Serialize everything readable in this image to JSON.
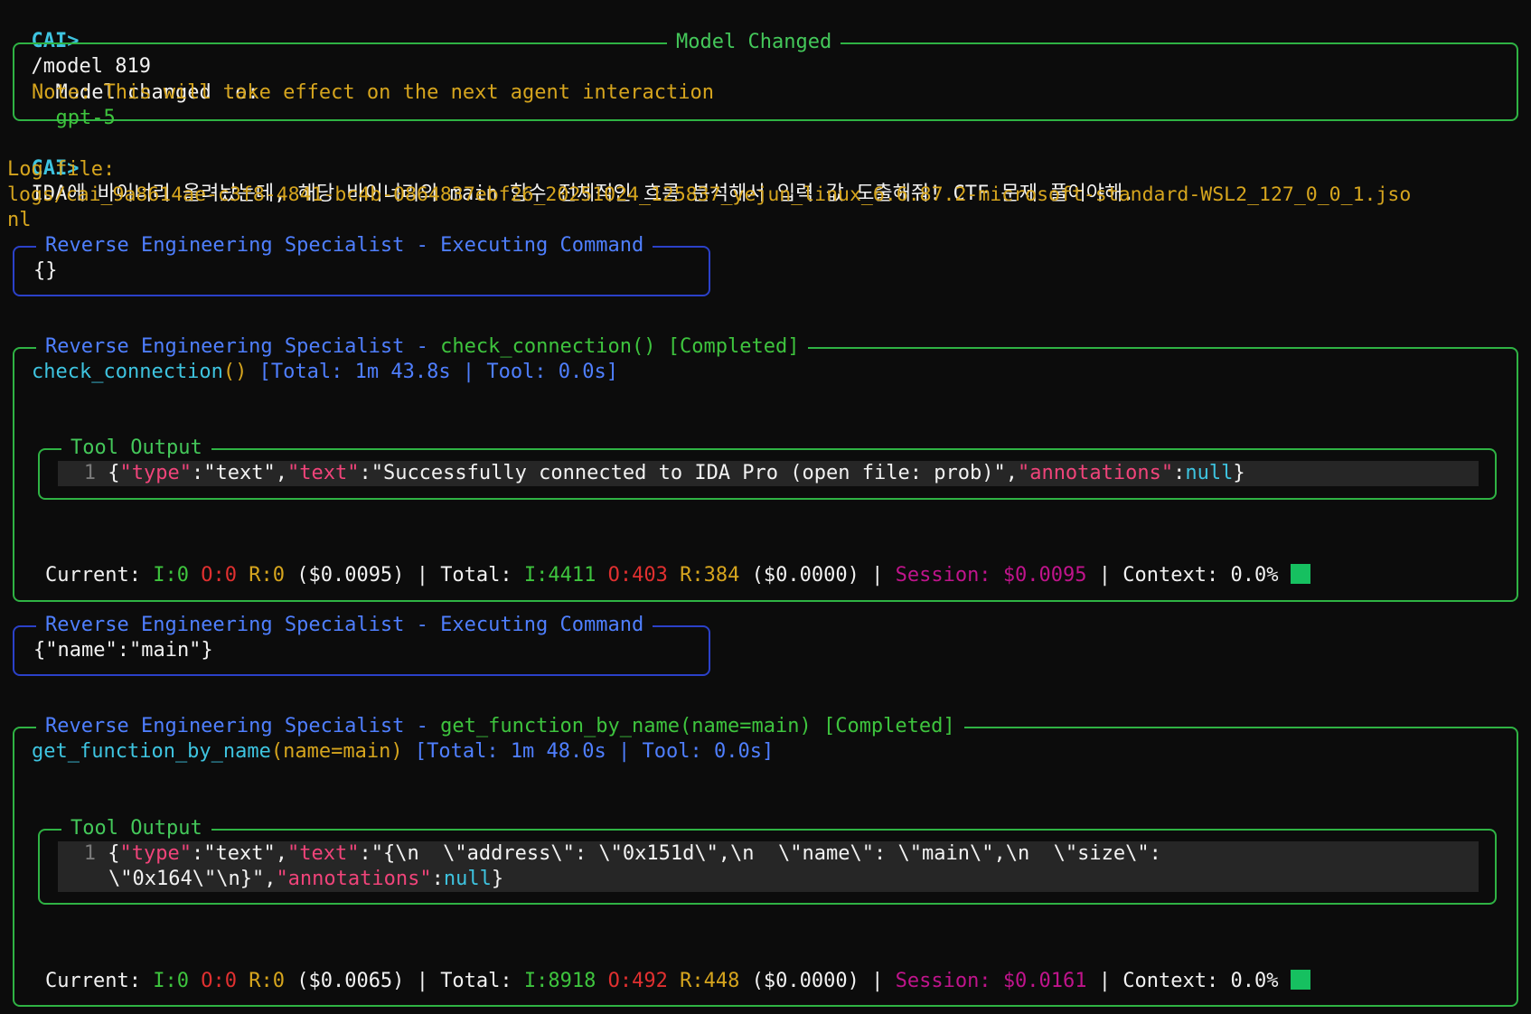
{
  "prompt_label": "CAI>",
  "command": "/model 819",
  "model_box": {
    "title": "Model Changed",
    "changed_label": "Model changed to:",
    "model_name": "gpt-5",
    "note": "Note: This will take effect on the next agent interaction"
  },
  "user_message": "IDA에 바이너리 올려놨는데, 해당 바이너리의 main 함수 전체적인 흐름 분석해서 입력 값 도출해줘! CTF 문제 풀어야해.",
  "log": {
    "label": "Log file:",
    "path_line1": "logs/cai_9a8614ae-c3f8-4841-bc4b-0864837ebf26_20251024_125837_yejun_linux_6.6.87.2-microsoft-standard-WSL2_127_0_0_1.jso",
    "path_line2": "nl"
  },
  "blocks": [
    {
      "exec_title": "Reverse Engineering Specialist - Executing Command",
      "exec_args": "{}",
      "call_agent": "Reverse Engineering Specialist",
      "call_sep": "-",
      "call_title": "check_connection() [Completed]",
      "fn_name": "check_connection",
      "fn_paren": "()",
      "fn_timing": " [Total: 1m 43.8s | Tool: 0.0s]",
      "output_title": "Tool Output",
      "line_no": "1",
      "out": {
        "k_type": "\"type\"",
        "v_type": "\"text\"",
        "k_text": "\"text\"",
        "v_text": "\"Successfully connected to IDA Pro (open file: prob)\"",
        "k_ann": "\"annotations\"",
        "v_ann": "null"
      },
      "stats": {
        "current_label": "Current:",
        "cur_i": "I:0",
        "cur_o": "O:0",
        "cur_r": "R:0",
        "cur_cost": "($0.0095)",
        "total_label": "Total:",
        "tot_i": "I:4411",
        "tot_o": "O:403",
        "tot_r": "R:384",
        "tot_cost": "($0.0000)",
        "session_label": "Session:",
        "session_val": "$0.0095",
        "context_label": "Context: 0.0%"
      }
    },
    {
      "exec_title": "Reverse Engineering Specialist - Executing Command",
      "exec_args": "{\"name\":\"main\"}",
      "call_agent": "Reverse Engineering Specialist",
      "call_sep": "-",
      "call_title": "get_function_by_name(name=main) [Completed]",
      "fn_name": "get_function_by_name",
      "fn_paren": "(name=main)",
      "fn_timing": " [Total: 1m 48.0s | Tool: 0.0s]",
      "output_title": "Tool Output",
      "line_no": "1",
      "out": {
        "k_type": "\"type\"",
        "v_type": "\"text\"",
        "k_text": "\"text\"",
        "v_text_1": "\"{\\n  \\\"address\\\": \\\"0x151d\\\",\\n  \\\"name\\\": \\\"main\\\",\\n  \\\"size\\\":",
        "v_text_2": "\\\"0x164\\\"\\n}\"",
        "k_ann": "\"annotations\"",
        "v_ann": "null"
      },
      "stats": {
        "current_label": "Current:",
        "cur_i": "I:0",
        "cur_o": "O:0",
        "cur_r": "R:0",
        "cur_cost": "($0.0065)",
        "total_label": "Total:",
        "tot_i": "I:8918",
        "tot_o": "O:492",
        "tot_r": "R:448",
        "tot_cost": "($0.0000)",
        "session_label": "Session:",
        "session_val": "$0.0161",
        "context_label": "Context: 0.0%"
      }
    }
  ],
  "colors": {
    "background": "#0c0c0c",
    "panel_border_green": "#2fb344",
    "panel_border_blue": "#2b41c9",
    "prompt_cyan": "#3ec4e0",
    "warning_gold": "#d6a51e"
  }
}
